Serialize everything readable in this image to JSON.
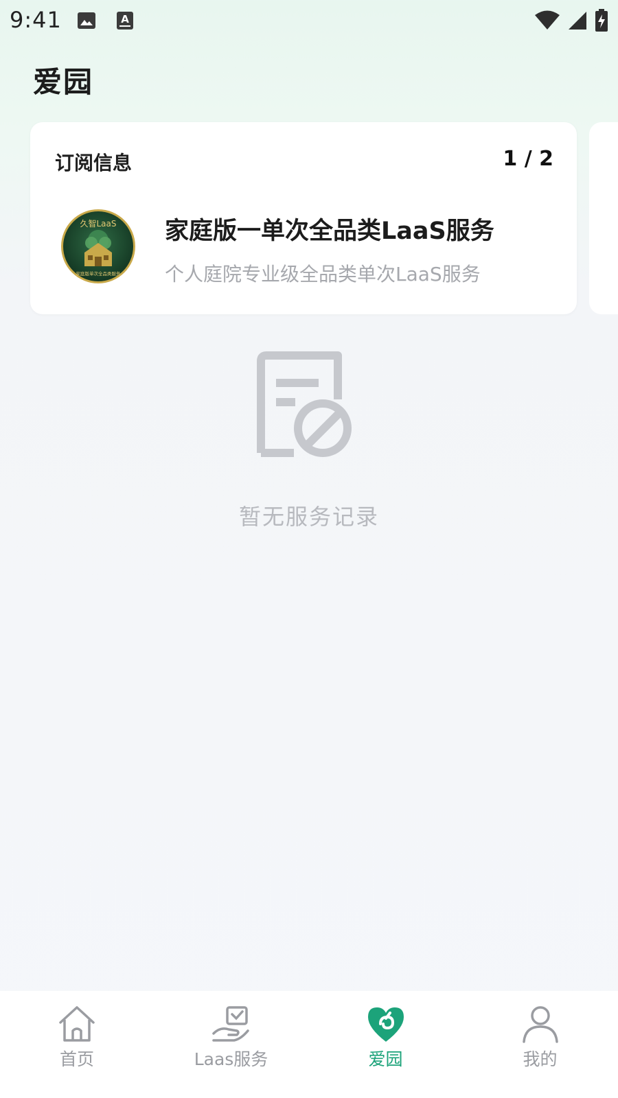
{
  "status_bar": {
    "time": "9:41"
  },
  "page": {
    "title": "爱园"
  },
  "subscription_card": {
    "title": "订阅信息",
    "pager": "1 / 2",
    "service_name": "家庭版一单次全品类LaaS服务",
    "service_desc": "个人庭院专业级全品类单次LaaS服务",
    "logo_text_top": "久智LaaS",
    "logo_text_bottom": "家庭版单次全品类服务"
  },
  "empty_state": {
    "text": "暂无服务记录"
  },
  "bottom_nav": {
    "items": [
      {
        "label": "首页",
        "icon": "home-icon",
        "active": false
      },
      {
        "label": "Laas服务",
        "icon": "service-hand-icon",
        "active": false
      },
      {
        "label": "爱园",
        "icon": "heart-garden-icon",
        "active": true
      },
      {
        "label": "我的",
        "icon": "profile-icon",
        "active": false
      }
    ]
  },
  "colors": {
    "accent": "#1ca37a",
    "inactive": "#9a9ca1",
    "logo_green": "#1c4a30",
    "logo_gold": "#c9a94a"
  }
}
